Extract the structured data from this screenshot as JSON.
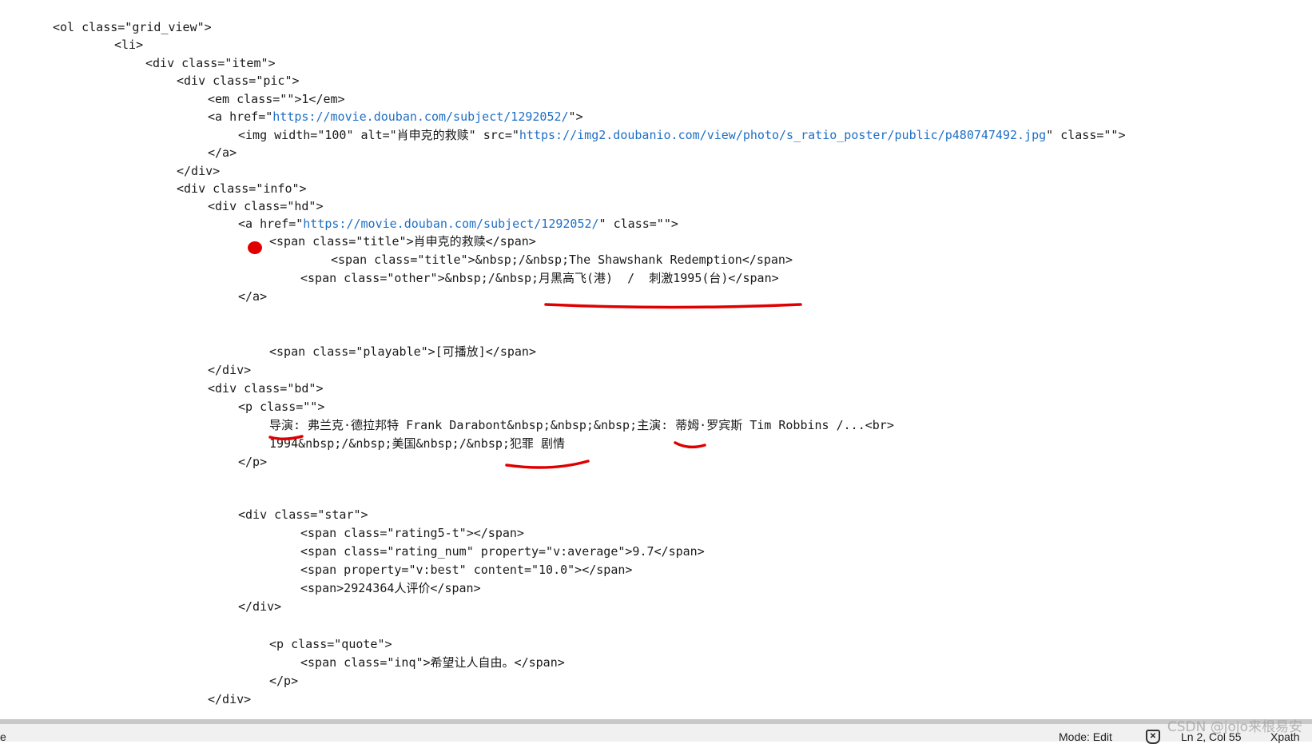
{
  "editor": {
    "lines": [
      {
        "text": "<ol class=\"grid_view\">"
      },
      {
        "text": "<li>"
      },
      {
        "text": "<div class=\"item\">"
      },
      {
        "text": "<div class=\"pic\">"
      },
      {
        "text": "<em class=\"\">1</em>"
      },
      {
        "pre": "<a href=\"",
        "link": "https://movie.douban.com/subject/1292052/",
        "post": "\">"
      },
      {
        "pre": "<img width=\"100\" alt=\"肖申克的救赎\" src=\"",
        "link": "https://img2.doubanio.com/view/photo/s_ratio_poster/public/p480747492.jpg",
        "post": "\" class=\"\">"
      },
      {
        "text": "</a>"
      },
      {
        "text": "</div>"
      },
      {
        "text": "<div class=\"info\">"
      },
      {
        "text": "<div class=\"hd\">"
      },
      {
        "pre": "<a href=\"",
        "link": "https://movie.douban.com/subject/1292052/",
        "post": "\" class=\"\">"
      },
      {
        "text": "<span class=\"title\">肖申克的救赎</span>"
      },
      {
        "text": "<span class=\"title\">&nbsp;/&nbsp;The Shawshank Redemption</span>"
      },
      {
        "text": "<span class=\"other\">&nbsp;/&nbsp;月黑高飞(港)  /  刺激1995(台)</span>"
      },
      {
        "text": "</a>"
      },
      {
        "text": "<span class=\"playable\">[可播放]</span>"
      },
      {
        "text": "</div>"
      },
      {
        "text": "<div class=\"bd\">"
      },
      {
        "text": "<p class=\"\">"
      },
      {
        "text": "导演: 弗兰克·德拉邦特 Frank Darabont&nbsp;&nbsp;&nbsp;主演: 蒂姆·罗宾斯 Tim Robbins /...<br>"
      },
      {
        "text": "1994&nbsp;/&nbsp;美国&nbsp;/&nbsp;犯罪 剧情"
      },
      {
        "text": "</p>"
      },
      {
        "text": "<div class=\"star\">"
      },
      {
        "text": "<span class=\"rating5-t\"></span>"
      },
      {
        "text": "<span class=\"rating_num\" property=\"v:average\">9.7</span>"
      },
      {
        "text": "<span property=\"v:best\" content=\"10.0\"></span>"
      },
      {
        "text": "<span>2924364人评价</span>"
      },
      {
        "text": "</div>"
      },
      {
        "text": "<p class=\"quote\">"
      },
      {
        "text": "<span class=\"inq\">希望让人自由。</span>"
      },
      {
        "text": "</p>"
      },
      {
        "text": "</div>"
      }
    ]
  },
  "colors": {
    "link": "#1f6fc5",
    "annotation": "#e00000",
    "text": "#1a1a1a"
  },
  "statusbar": {
    "left_fragment": "e",
    "mode": "Mode: Edit",
    "position": "Ln 2, Col 55",
    "xpath_label": "Xpath",
    "icon": "shield-x-icon"
  },
  "watermark": "CSDN @jojo来根易安"
}
